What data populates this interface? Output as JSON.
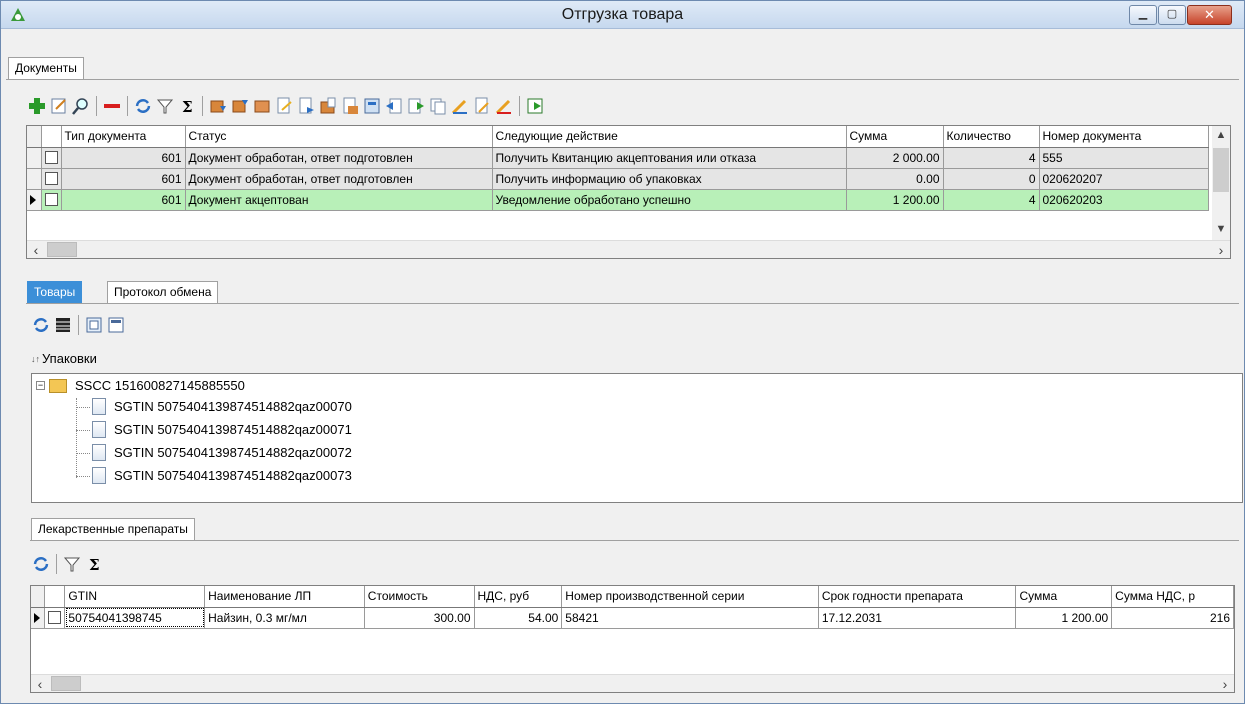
{
  "window": {
    "title": "Отгрузка товара"
  },
  "top_tabs": [
    {
      "label": "Документы"
    }
  ],
  "documents_grid": {
    "columns": [
      "Тип документа",
      "Статус",
      "Следующие действие",
      "Сумма",
      "Количество",
      "Номер документа"
    ],
    "rows": [
      {
        "type": "601",
        "status": "Документ обработан, ответ подготовлен",
        "next_action": "Получить Квитанцию акцептования или отказа",
        "sum": "2 000.00",
        "qty": "4",
        "number": "555"
      },
      {
        "type": "601",
        "status": "Документ обработан, ответ подготовлен",
        "next_action": "Получить информацию об упаковках",
        "sum": "0.00",
        "qty": "0",
        "number": "020620207"
      },
      {
        "type": "601",
        "status": "Документ акцептован",
        "next_action": "Уведомление обработано успешно",
        "sum": "1 200.00",
        "qty": "4",
        "number": "020620203"
      }
    ]
  },
  "middle_tabs": [
    {
      "label": "Товары"
    },
    {
      "label": "Протокол обмена"
    }
  ],
  "packages": {
    "label": "Упаковки",
    "root": "SSCC 151600827145885550",
    "children": [
      "SGTIN 5075404139874514882qaz00070",
      "SGTIN 5075404139874514882qaz00071",
      "SGTIN 5075404139874514882qaz00072",
      "SGTIN 5075404139874514882qaz00073"
    ]
  },
  "bottom_tabs": [
    {
      "label": "Лекарственные препараты"
    }
  ],
  "drugs_grid": {
    "columns": [
      "GTIN",
      "Наименование ЛП",
      "Стоимость",
      "НДС, руб",
      "Номер производственной серии",
      "Срок годности препарата",
      "Сумма",
      "Сумма НДС, р"
    ],
    "rows": [
      {
        "gtin": "50754041398745",
        "name": "Найзин, 0.3 мг/мл",
        "cost": "300.00",
        "vat": "54.00",
        "series": "58421",
        "expiry": "17.12.2031",
        "sum": "1 200.00",
        "vat_sum": "216"
      }
    ]
  },
  "colors": {
    "selected_row": "#b8f0b8",
    "active_tab": "#3c8fd8",
    "processed_row": "#e5e5e5"
  }
}
